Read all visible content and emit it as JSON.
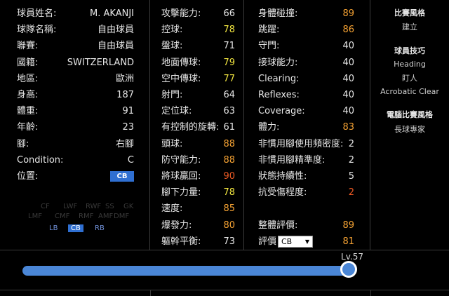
{
  "profile": [
    {
      "label": "球員姓名:",
      "value": "M. AKANJI"
    },
    {
      "label": "球隊名稱:",
      "value": "自由球員"
    },
    {
      "label": "聯賽:",
      "value": "自由球員"
    },
    {
      "label": "國籍:",
      "value": "SWITZERLAND"
    },
    {
      "label": "地區:",
      "value": "歐洲"
    },
    {
      "label": "身高:",
      "value": "187"
    },
    {
      "label": "體重:",
      "value": "91"
    },
    {
      "label": "年齡:",
      "value": "23"
    },
    {
      "label": "腳:",
      "value": "右腳"
    },
    {
      "label": "Condition:",
      "value": "C"
    },
    {
      "label": "位置:",
      "value": "CB"
    }
  ],
  "position_map": {
    "ghost": [
      "CF",
      "LWF",
      "RWF",
      "SS",
      "LMF",
      "CMF",
      "RMF",
      "AMF",
      "DMF",
      "GK"
    ],
    "small": [
      "LB",
      "CB",
      "RB"
    ],
    "active": "CB"
  },
  "stats1": [
    {
      "label": "攻擊能力:",
      "value": "66",
      "color": "white"
    },
    {
      "label": "控球:",
      "value": "78",
      "color": "yellow"
    },
    {
      "label": "盤球:",
      "value": "71",
      "color": "white"
    },
    {
      "label": "地面傳球:",
      "value": "79",
      "color": "yellow"
    },
    {
      "label": "空中傳球:",
      "value": "77",
      "color": "yellow"
    },
    {
      "label": "射門:",
      "value": "64",
      "color": "white"
    },
    {
      "label": "定位球:",
      "value": "63",
      "color": "white"
    },
    {
      "label": "有控制的旋轉:",
      "value": "61",
      "color": "white"
    },
    {
      "label": "頭球:",
      "value": "88",
      "color": "orange"
    },
    {
      "label": "防守能力:",
      "value": "88",
      "color": "orange"
    },
    {
      "label": "將球贏回:",
      "value": "90",
      "color": "red"
    },
    {
      "label": "腳下力量:",
      "value": "78",
      "color": "yellow"
    },
    {
      "label": "速度:",
      "value": "85",
      "color": "orange"
    },
    {
      "label": "爆發力:",
      "value": "80",
      "color": "orange"
    },
    {
      "label": "軀幹平衡:",
      "value": "73",
      "color": "white"
    }
  ],
  "stats2": [
    {
      "label": "身體碰撞:",
      "value": "89",
      "color": "orange"
    },
    {
      "label": "跳躍:",
      "value": "86",
      "color": "orange"
    },
    {
      "label": "守門:",
      "value": "40",
      "color": "white"
    },
    {
      "label": "接球能力:",
      "value": "40",
      "color": "white"
    },
    {
      "label": "Clearing:",
      "value": "40",
      "color": "white"
    },
    {
      "label": "Reflexes:",
      "value": "40",
      "color": "white"
    },
    {
      "label": "Coverage:",
      "value": "40",
      "color": "white"
    },
    {
      "label": "體力:",
      "value": "83",
      "color": "orange"
    },
    {
      "label": "非慣用腳使用頻密度:",
      "value": "2",
      "color": "white"
    },
    {
      "label": "非慣用腳精準度:",
      "value": "2",
      "color": "white"
    },
    {
      "label": "狀態持續性:",
      "value": "5",
      "color": "white"
    },
    {
      "label": "抗受傷程度:",
      "value": "2",
      "color": "red"
    }
  ],
  "overall": {
    "label": "整體評價:",
    "value": "89",
    "color": "orange"
  },
  "rating": {
    "label": "評價",
    "select_value": "CB",
    "value": "81",
    "color": "orange"
  },
  "side": {
    "style_title": "比賽風格",
    "style_items": [
      "建立"
    ],
    "skills_title": "球員技巧",
    "skills_items": [
      "Heading",
      "盯人",
      "Acrobatic Clear"
    ],
    "com_title": "電腦比賽風格",
    "com_items": [
      "長球專家"
    ]
  },
  "level": {
    "label": "Lv.57",
    "fraction": 1.0
  },
  "colors": {
    "yellow": "#f2e640",
    "orange": "#f5a233",
    "red": "#ee5a24",
    "accent": "#2f6fd1",
    "slider": "#4a86d6"
  }
}
